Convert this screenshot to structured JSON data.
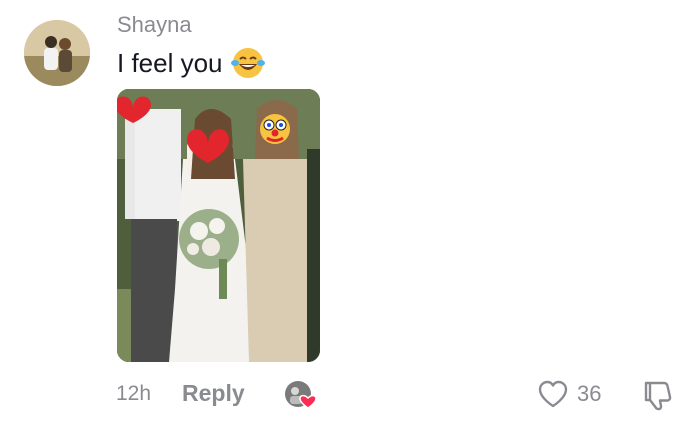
{
  "comment": {
    "username": "Shayna",
    "text": "I feel you",
    "emoji": "tears-of-joy-emoji",
    "time": "12h",
    "reply_label": "Reply",
    "like_count": "36",
    "liked_by_creator": true
  },
  "attachment": {
    "type": "photo",
    "subject": "wedding-party-with-emoji-covered-faces",
    "emojis": [
      "red-heart",
      "red-heart",
      "clown-face"
    ]
  },
  "colors": {
    "text_primary": "#161823",
    "text_secondary": "#8a8b91",
    "heart": "#fe2c55"
  }
}
